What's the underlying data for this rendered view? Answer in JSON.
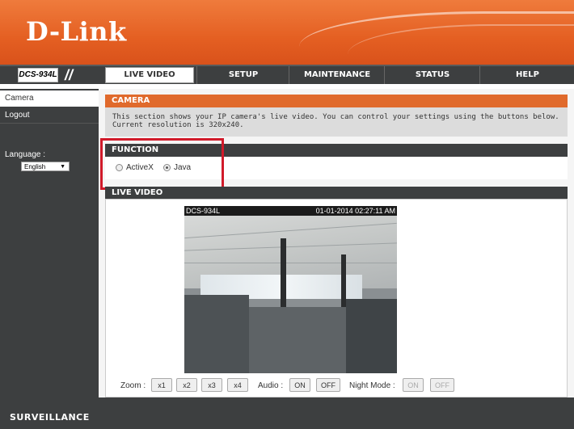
{
  "brand": {
    "logo": "D-Link",
    "model": "DCS-934L"
  },
  "nav": {
    "tabs": [
      "LIVE VIDEO",
      "SETUP",
      "MAINTENANCE",
      "STATUS",
      "HELP"
    ],
    "active": "LIVE VIDEO"
  },
  "sidebar": {
    "items": [
      "Camera",
      "Logout"
    ],
    "language_label": "Language :",
    "language_value": "English"
  },
  "camera_section": {
    "title": "CAMERA",
    "description_line1": "This section shows your IP camera's live video. You can control your settings using the buttons below.",
    "description_line2": "Current resolution is 320x240."
  },
  "function_section": {
    "title": "FUNCTION",
    "options": [
      "ActiveX",
      "Java"
    ],
    "selected": "Java"
  },
  "live_video": {
    "title": "LIVE VIDEO",
    "overlay_camera": "DCS-934L",
    "overlay_timestamp": "01-01-2014 02:27:11 AM"
  },
  "controls": {
    "zoom_label": "Zoom :",
    "zoom_buttons": [
      "x1",
      "x2",
      "x3",
      "x4"
    ],
    "audio_label": "Audio :",
    "audio_on": "ON",
    "audio_off": "OFF",
    "night_label": "Night Mode :",
    "night_on": "ON",
    "night_off": "OFF"
  },
  "footer": {
    "text": "SURVEILLANCE"
  },
  "colors": {
    "brand_orange": "#e45f22",
    "dark_bar": "#3d3f40",
    "section_orange": "#e06a2c",
    "highlight_red": "#d11a2a"
  }
}
